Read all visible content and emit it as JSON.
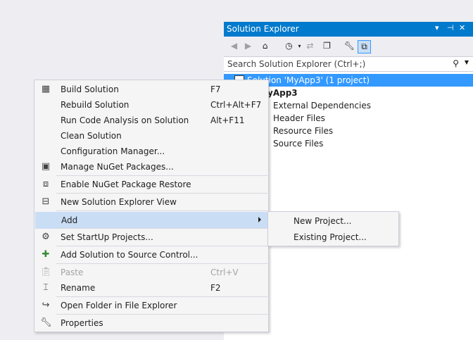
{
  "solution_explorer": {
    "title": "Solution Explorer",
    "title_controls": [
      "▾",
      "⊣",
      "✕"
    ],
    "toolbar": {
      "back_icon": "back-arrow-icon",
      "forward_icon": "forward-arrow-icon",
      "home_icon": "home-icon",
      "history_icon": "history-icon",
      "sync_icon": "sync-icon",
      "collapse_icon": "collapse-all-icon",
      "properties_icon": "wrench-icon",
      "preview_icon": "preview-icon"
    },
    "search_placeholder": "Search Solution Explorer (Ctrl+;)",
    "tree": {
      "solution": "Solution 'MyApp3' (1 project)",
      "project": "yApp3",
      "items": [
        "External Dependencies",
        "Header Files",
        "Resource Files",
        "Source Files"
      ]
    }
  },
  "context_menu": {
    "items": [
      {
        "label": "Build Solution",
        "shortcut": "F7",
        "icon": "build-icon"
      },
      {
        "label": "Rebuild Solution",
        "shortcut": "Ctrl+Alt+F7"
      },
      {
        "label": "Run Code Analysis on Solution",
        "shortcut": "Alt+F11"
      },
      {
        "label": "Clean Solution",
        "shortcut": ""
      },
      {
        "label": "Configuration Manager...",
        "shortcut": ""
      },
      {
        "label": "Manage NuGet Packages...",
        "shortcut": "",
        "icon": "nuget-icon"
      },
      {
        "label": "Enable NuGet Package Restore",
        "shortcut": "",
        "icon": "package-restore-icon"
      },
      {
        "label": "New Solution Explorer View",
        "shortcut": "",
        "icon": "new-view-icon"
      },
      {
        "label": "Add",
        "shortcut": "",
        "submenu": true
      },
      {
        "label": "Set StartUp Projects...",
        "shortcut": "",
        "icon": "gear-icon"
      },
      {
        "label": "Add Solution to Source Control...",
        "shortcut": "",
        "icon": "source-control-icon"
      },
      {
        "label": "Paste",
        "shortcut": "Ctrl+V",
        "icon": "paste-icon",
        "disabled": true
      },
      {
        "label": "Rename",
        "shortcut": "F2",
        "icon": "rename-icon"
      },
      {
        "label": "Open Folder in File Explorer",
        "shortcut": "",
        "icon": "open-folder-icon"
      },
      {
        "label": "Properties",
        "shortcut": "",
        "icon": "wrench-icon"
      }
    ]
  },
  "submenu": {
    "items": [
      {
        "label": "New Project..."
      },
      {
        "label": "Existing Project..."
      }
    ]
  },
  "colors": {
    "accent": "#007acc",
    "selection": "#3399ff",
    "hover": "#c9def5"
  }
}
